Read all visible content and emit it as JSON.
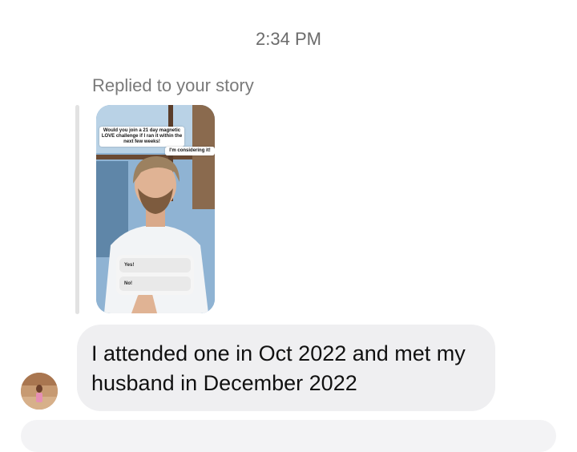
{
  "timestamp": "2:34 PM",
  "replied_label": "Replied to your story",
  "story": {
    "question_sticker": "Would you join a 21 day magnetic LOVE challenge if I ran it within the next few weeks!",
    "reply_sticker": "I'm considering it!",
    "poll_options": [
      "Yes!",
      "No!"
    ]
  },
  "message": {
    "text": "I attended one in Oct 2022 and met my husband in December 2022"
  },
  "colors": {
    "bubble_bg": "#efeff1",
    "timestamp_text": "#6b6b6b",
    "reply_bar": "#e2e2e2"
  }
}
